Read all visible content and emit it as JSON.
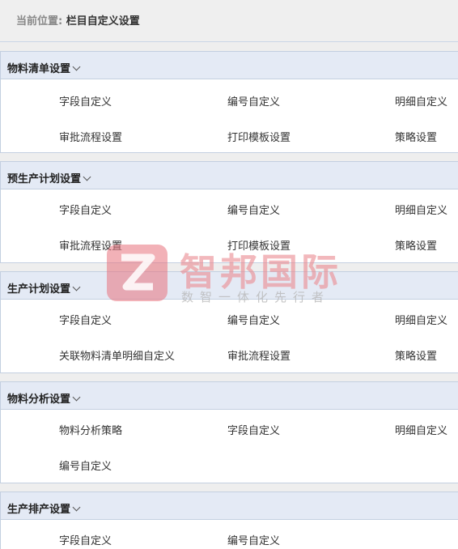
{
  "breadcrumb": {
    "prefix": "当前位置:",
    "current": "栏目自定义设置"
  },
  "sections": [
    {
      "title": "物料清单设置",
      "items": [
        "字段自定义",
        "编号自定义",
        "明细自定义",
        "审批流程设置",
        "打印模板设置",
        "策略设置"
      ]
    },
    {
      "title": "预生产计划设置",
      "items": [
        "字段自定义",
        "编号自定义",
        "明细自定义",
        "审批流程设置",
        "打印模板设置",
        "策略设置"
      ]
    },
    {
      "title": "生产计划设置",
      "items": [
        "字段自定义",
        "编号自定义",
        "明细自定义",
        "关联物料清单明细自定义",
        "审批流程设置",
        "策略设置"
      ]
    },
    {
      "title": "物料分析设置",
      "items": [
        "物料分析策略",
        "字段自定义",
        "明细自定义",
        "编号自定义"
      ]
    },
    {
      "title": "生产排产设置",
      "items": [
        "字段自定义",
        "编号自定义"
      ]
    }
  ],
  "watermark": {
    "title": "智邦国际",
    "subtitle": "数智一体化先行者"
  },
  "colors": {
    "header_bg": "#e4eaf5",
    "border": "#c3cfe0",
    "watermark": "#e8717b"
  }
}
